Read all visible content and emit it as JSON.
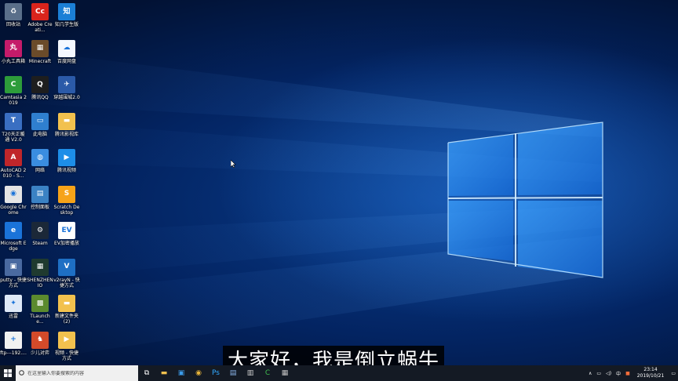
{
  "desktop_icons": [
    {
      "label": "回收站",
      "icon": "recycle-bin-icon",
      "bg": "#5a6f8a",
      "glyph": "♻"
    },
    {
      "label": "Adobe Creati...",
      "icon": "adobe-icon",
      "bg": "#d9241c",
      "glyph": "Cc"
    },
    {
      "label": "知几学生版",
      "icon": "zhiji-icon",
      "bg": "#1b7fd6",
      "glyph": "知"
    },
    {
      "label": "小丸工具箱",
      "icon": "xiaowan-icon",
      "bg": "#c51b6a",
      "glyph": "丸"
    },
    {
      "label": "Minecraft",
      "icon": "minecraft-icon",
      "bg": "#6b4b2a",
      "glyph": "▦"
    },
    {
      "label": "百度网盘",
      "icon": "baidu-netdisk-icon",
      "bg": "#f4f8ff",
      "glyph": "☁"
    },
    {
      "label": "Camtasia 2019",
      "icon": "camtasia-icon",
      "bg": "#2d9c3a",
      "glyph": "C"
    },
    {
      "label": "腾讯QQ",
      "icon": "qq-icon",
      "bg": "#1e1e1e",
      "glyph": "Q"
    },
    {
      "label": "穿越围城2.0",
      "icon": "game-icon",
      "bg": "#2b5aa8",
      "glyph": "✈"
    },
    {
      "label": "T20天正暖通 V2.0",
      "icon": "t20-icon",
      "bg": "#3a6fc2",
      "glyph": "T"
    },
    {
      "label": "此电脑",
      "icon": "this-pc-icon",
      "bg": "#2f7fcf",
      "glyph": "▭"
    },
    {
      "label": "腾讯影视库",
      "icon": "folder-icon",
      "bg": "#f2c14e",
      "glyph": "▬"
    },
    {
      "label": "AutoCAD 2010 - S...",
      "icon": "autocad-icon",
      "bg": "#c0262a",
      "glyph": "A"
    },
    {
      "label": "网络",
      "icon": "network-icon",
      "bg": "#3a8de0",
      "glyph": "◍"
    },
    {
      "label": "腾讯视频",
      "icon": "tencent-video-icon",
      "bg": "#1d8ee8",
      "glyph": "▶"
    },
    {
      "label": "Google Chrome",
      "icon": "chrome-icon",
      "bg": "#e5e5e5",
      "glyph": "◉"
    },
    {
      "label": "控制面板",
      "icon": "control-panel-icon",
      "bg": "#3b82c4",
      "glyph": "▤"
    },
    {
      "label": "Scratch Desktop",
      "icon": "scratch-icon",
      "bg": "#f6a319",
      "glyph": "S"
    },
    {
      "label": "Microsoft Edge",
      "icon": "edge-icon",
      "bg": "#1a73d9",
      "glyph": "e"
    },
    {
      "label": "Steam",
      "icon": "steam-icon",
      "bg": "#1b2838",
      "glyph": "⚙"
    },
    {
      "label": "EV加密播放",
      "icon": "ev-player-icon",
      "bg": "#ffffff",
      "glyph": "EV"
    },
    {
      "label": "putty - 快捷方式",
      "icon": "putty-icon",
      "bg": "#4a6aa0",
      "glyph": "▣"
    },
    {
      "label": "SHENZHEN IO",
      "icon": "shenzhen-io-icon",
      "bg": "#1f3a2f",
      "glyph": "▦"
    },
    {
      "label": "v2rayN - 快捷方式",
      "icon": "v2rayn-icon",
      "bg": "#1e6fc4",
      "glyph": "V"
    },
    {
      "label": "迅雷",
      "icon": "xunlei-icon",
      "bg": "#dfe9f7",
      "glyph": "✦"
    },
    {
      "label": "TLaunche...",
      "icon": "tlauncher-icon",
      "bg": "#5b8a2e",
      "glyph": "▩"
    },
    {
      "label": "新建文件夹 (2)",
      "icon": "folder-icon",
      "bg": "#f2c14e",
      "glyph": "▬"
    },
    {
      "label": "ftp---192....",
      "icon": "ftp-file-icon",
      "bg": "#f1f1f1",
      "glyph": "+"
    },
    {
      "label": "少儿对弈",
      "icon": "chess-game-icon",
      "bg": "#d34a2a",
      "glyph": "♞"
    },
    {
      "label": "视频 - 快捷方式",
      "icon": "video-folder-icon",
      "bg": "#f2c14e",
      "glyph": "▶"
    }
  ],
  "subtitle": "大家好，我是倒立蜗牛",
  "taskbar": {
    "search_placeholder": "在这里输入你要搜索的内容",
    "apps": [
      {
        "name": "task-view-icon",
        "glyph": "⧉",
        "color": "#ffffff"
      },
      {
        "name": "file-explorer-icon",
        "glyph": "▬",
        "color": "#f2c14e"
      },
      {
        "name": "store-icon",
        "glyph": "▣",
        "color": "#3b9be8"
      },
      {
        "name": "chrome-icon",
        "glyph": "◉",
        "color": "#e8b43a"
      },
      {
        "name": "photoshop-icon",
        "glyph": "Ps",
        "color": "#31a8ff"
      },
      {
        "name": "app-icon",
        "glyph": "▤",
        "color": "#8ab4e8"
      },
      {
        "name": "app-icon-2",
        "glyph": "▥",
        "color": "#d0d0d0"
      },
      {
        "name": "camtasia-icon",
        "glyph": "C",
        "color": "#3fbf4f"
      },
      {
        "name": "app-icon-3",
        "glyph": "▦",
        "color": "#c0c0c0"
      }
    ],
    "tray": {
      "chevron": "∧",
      "ime": "中",
      "time": "23:14",
      "date": "2019/10/21"
    }
  }
}
